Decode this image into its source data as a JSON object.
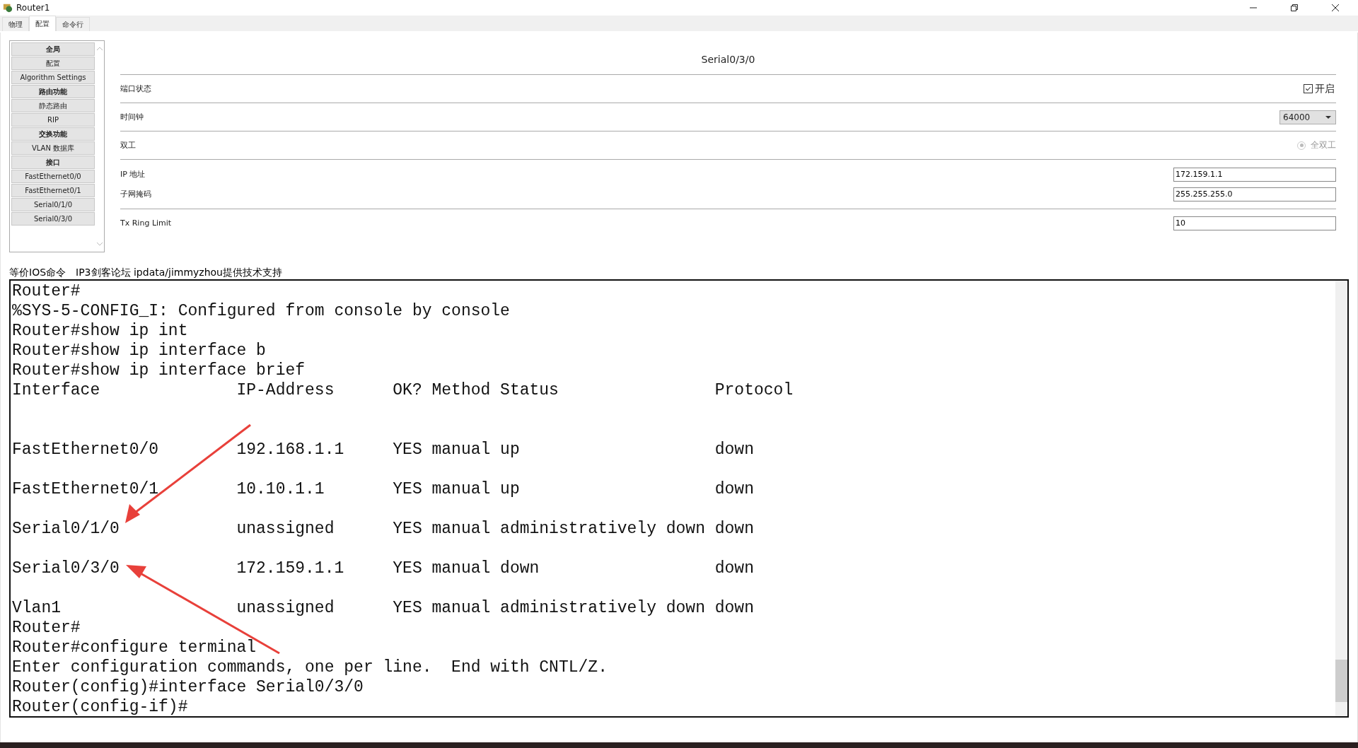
{
  "window": {
    "title": "Router1"
  },
  "tabs": [
    {
      "label": "物理",
      "selected": false
    },
    {
      "label": "配置",
      "selected": true
    },
    {
      "label": "命令行",
      "selected": false
    }
  ],
  "sidebar": {
    "items": [
      {
        "label": "全局",
        "kind": "header"
      },
      {
        "label": "配置",
        "kind": "item"
      },
      {
        "label": "Algorithm Settings",
        "kind": "item"
      },
      {
        "label": "路由功能",
        "kind": "header"
      },
      {
        "label": "静态路由",
        "kind": "item"
      },
      {
        "label": "RIP",
        "kind": "item"
      },
      {
        "label": "交换功能",
        "kind": "header"
      },
      {
        "label": "VLAN 数据库",
        "kind": "item"
      },
      {
        "label": "接口",
        "kind": "header"
      },
      {
        "label": "FastEthernet0/0",
        "kind": "item"
      },
      {
        "label": "FastEthernet0/1",
        "kind": "item"
      },
      {
        "label": "Serial0/1/0",
        "kind": "item"
      },
      {
        "label": "Serial0/3/0",
        "kind": "item"
      }
    ]
  },
  "panel": {
    "title": "Serial0/3/0",
    "port_status": {
      "label": "端口状态",
      "option": "开启",
      "checked": true
    },
    "clock": {
      "label": "时间钟",
      "value": "64000"
    },
    "duplex": {
      "label": "双工",
      "option": "全双工",
      "selected": true,
      "disabled": true
    },
    "ip_address": {
      "label": "IP 地址",
      "value": "172.159.1.1"
    },
    "subnet_mask": {
      "label": "子网掩码",
      "value": "255.255.255.0"
    },
    "tx_ring_limit": {
      "label": "Tx Ring Limit",
      "value": "10"
    }
  },
  "ios_label": "等价IOS命令　IP3剑客论坛 ipdata/jimmyzhou提供技术支持",
  "terminal": {
    "lines": [
      {
        "text": "Router#",
        "kind": "line"
      },
      {
        "text": "%SYS-5-CONFIG_I: Configured from console by console",
        "kind": "line"
      },
      {
        "text": "Router#show ip int",
        "kind": "line"
      },
      {
        "text": "Router#show ip interface b",
        "kind": "line"
      },
      {
        "text": "Router#show ip interface brief",
        "kind": "line"
      },
      {
        "text": "Interface              IP-Address      OK? Method Status                Protocol",
        "kind": "line"
      },
      {
        "text": "FastEthernet0/0        192.168.1.1     YES manual up                    down",
        "kind": "first-row"
      },
      {
        "text": "FastEthernet0/1        10.10.1.1       YES manual up                    down",
        "kind": "row"
      },
      {
        "text": "Serial0/1/0            unassigned      YES manual administratively down down",
        "kind": "row"
      },
      {
        "text": "Serial0/3/0            172.159.1.1     YES manual down                  down",
        "kind": "row"
      },
      {
        "text": "Vlan1                  unassigned      YES manual administratively down down",
        "kind": "row"
      },
      {
        "text": "Router#",
        "kind": "line"
      },
      {
        "text": "Router#configure terminal",
        "kind": "line"
      },
      {
        "text": "Enter configuration commands, one per line.  End with CNTL/Z.",
        "kind": "line"
      },
      {
        "text": "Router(config)#interface Serial0/3/0",
        "kind": "line"
      },
      {
        "text": "Router(config-if)#",
        "kind": "line"
      }
    ]
  }
}
